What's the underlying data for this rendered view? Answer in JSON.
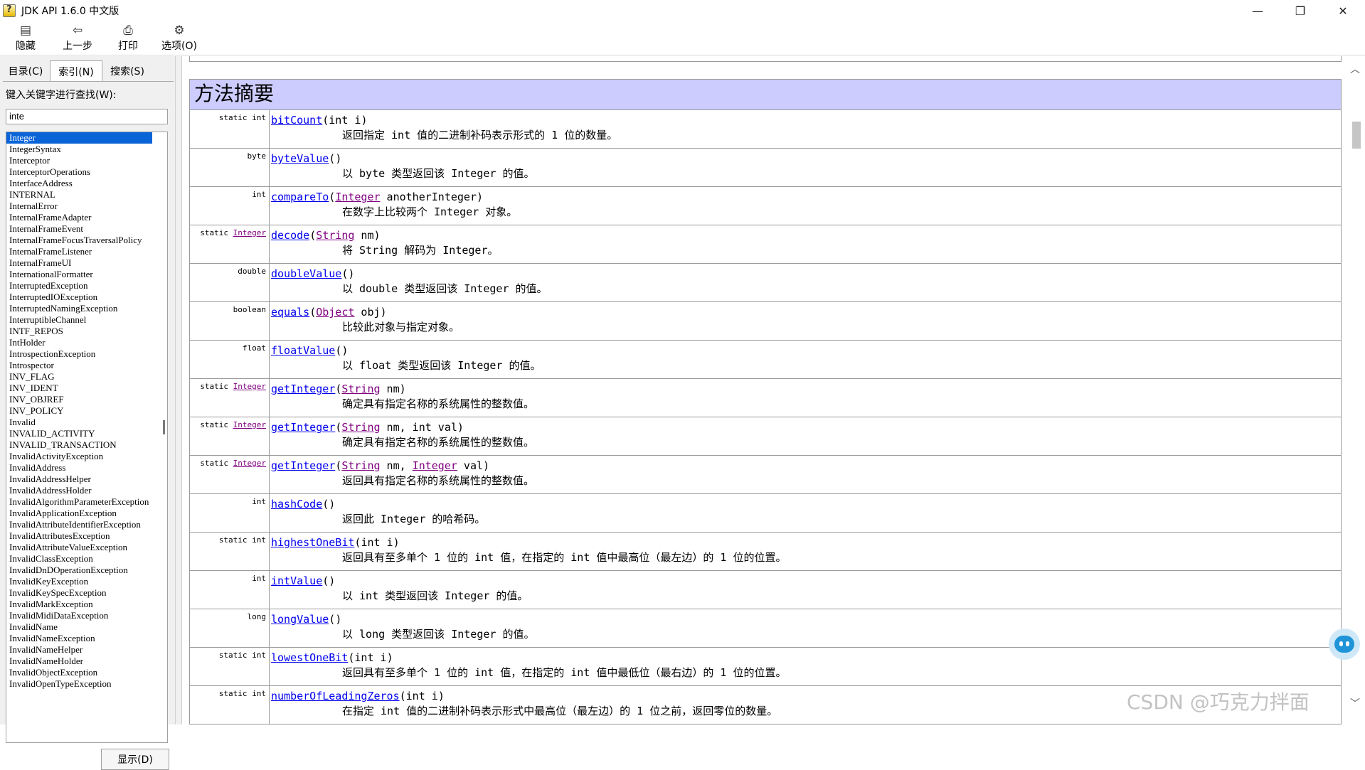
{
  "window": {
    "title": "JDK API 1.6.0 中文版",
    "minimize_glyph": "—",
    "restore_glyph": "❐",
    "close_glyph": "✕"
  },
  "toolbar": {
    "hide": {
      "label": "隐藏",
      "icon": "hide-icon",
      "glyph": "▤"
    },
    "back": {
      "label": "上一步",
      "icon": "back-arrow-icon",
      "glyph": "⇦"
    },
    "print": {
      "label": "打印",
      "icon": "printer-icon",
      "glyph": "⎙"
    },
    "options": {
      "label": "选项(O)",
      "icon": "options-icon",
      "glyph": "⚙"
    }
  },
  "left": {
    "tabs": [
      {
        "label": "目录(C)"
      },
      {
        "label": "索引(N)"
      },
      {
        "label": "搜索(S)"
      }
    ],
    "keyword_label": "键入关键字进行查找(W):",
    "keyword_value": "inte",
    "selected_item": "Integer",
    "items": [
      "Integer",
      "IntegerSyntax",
      "Interceptor",
      "InterceptorOperations",
      "InterfaceAddress",
      "INTERNAL",
      "InternalError",
      "InternalFrameAdapter",
      "InternalFrameEvent",
      "InternalFrameFocusTraversalPolicy",
      "InternalFrameListener",
      "InternalFrameUI",
      "InternationalFormatter",
      "InterruptedException",
      "InterruptedIOException",
      "InterruptedNamingException",
      "InterruptibleChannel",
      "INTF_REPOS",
      "IntHolder",
      "IntrospectionException",
      "Introspector",
      "INV_FLAG",
      "INV_IDENT",
      "INV_OBJREF",
      "INV_POLICY",
      "Invalid",
      "INVALID_ACTIVITY",
      "INVALID_TRANSACTION",
      "InvalidActivityException",
      "InvalidAddress",
      "InvalidAddressHelper",
      "InvalidAddressHolder",
      "InvalidAlgorithmParameterException",
      "InvalidApplicationException",
      "InvalidAttributeIdentifierException",
      "InvalidAttributesException",
      "InvalidAttributeValueException",
      "InvalidClassException",
      "InvalidDnDOperationException",
      "InvalidKeyException",
      "InvalidKeySpecException",
      "InvalidMarkException",
      "InvalidMidiDataException",
      "InvalidName",
      "InvalidNameException",
      "InvalidNameHelper",
      "InvalidNameHolder",
      "InvalidObjectException",
      "InvalidOpenTypeException"
    ],
    "show_button": "显示(D)"
  },
  "content": {
    "section_title": "方法摘要",
    "methods": [
      {
        "modifier": "static int",
        "modifier_link": "",
        "name": "bitCount",
        "params": [
          {
            "text": "int i",
            "link": false
          }
        ],
        "desc": "返回指定 int 值的二进制补码表示形式的 1 位的数量。"
      },
      {
        "modifier": "byte",
        "modifier_link": "",
        "name": "byteValue",
        "params": [],
        "desc": "以 byte 类型返回该 Integer 的值。"
      },
      {
        "modifier": "int",
        "modifier_link": "",
        "name": "compareTo",
        "params": [
          {
            "text": "Integer",
            "link": true
          },
          {
            "text": " anotherInteger",
            "link": false
          }
        ],
        "desc": "在数字上比较两个 Integer 对象。"
      },
      {
        "modifier": "static ",
        "modifier_link": "Integer",
        "name": "decode",
        "params": [
          {
            "text": "String",
            "link": true
          },
          {
            "text": " nm",
            "link": false
          }
        ],
        "desc": "将 String 解码为 Integer。"
      },
      {
        "modifier": "double",
        "modifier_link": "",
        "name": "doubleValue",
        "params": [],
        "desc": "以 double 类型返回该 Integer 的值。"
      },
      {
        "modifier": "boolean",
        "modifier_link": "",
        "name": "equals",
        "params": [
          {
            "text": "Object",
            "link": true
          },
          {
            "text": " obj",
            "link": false
          }
        ],
        "desc": "比较此对象与指定对象。"
      },
      {
        "modifier": "float",
        "modifier_link": "",
        "name": "floatValue",
        "params": [],
        "desc": "以 float 类型返回该 Integer 的值。"
      },
      {
        "modifier": "static ",
        "modifier_link": "Integer",
        "name": "getInteger",
        "params": [
          {
            "text": "String",
            "link": true
          },
          {
            "text": " nm",
            "link": false
          }
        ],
        "desc": "确定具有指定名称的系统属性的整数值。"
      },
      {
        "modifier": "static ",
        "modifier_link": "Integer",
        "name": "getInteger",
        "params": [
          {
            "text": "String",
            "link": true
          },
          {
            "text": " nm, int val",
            "link": false
          }
        ],
        "desc": "确定具有指定名称的系统属性的整数值。"
      },
      {
        "modifier": "static ",
        "modifier_link": "Integer",
        "name": "getInteger",
        "params": [
          {
            "text": "String",
            "link": true
          },
          {
            "text": " nm, ",
            "link": false
          },
          {
            "text": "Integer",
            "link": true
          },
          {
            "text": " val",
            "link": false
          }
        ],
        "desc": "返回具有指定名称的系统属性的整数值。"
      },
      {
        "modifier": "int",
        "modifier_link": "",
        "name": "hashCode",
        "params": [],
        "desc": "返回此 Integer 的哈希码。"
      },
      {
        "modifier": "static int",
        "modifier_link": "",
        "name": "highestOneBit",
        "params": [
          {
            "text": "int i",
            "link": false
          }
        ],
        "desc": "返回具有至多单个 1 位的 int 值，在指定的 int 值中最高位（最左边）的 1 位的位置。"
      },
      {
        "modifier": "int",
        "modifier_link": "",
        "name": "intValue",
        "params": [],
        "desc": "以 int 类型返回该 Integer 的值。"
      },
      {
        "modifier": "long",
        "modifier_link": "",
        "name": "longValue",
        "params": [],
        "desc": "以 long 类型返回该 Integer 的值。"
      },
      {
        "modifier": "static int",
        "modifier_link": "",
        "name": "lowestOneBit",
        "params": [
          {
            "text": "int i",
            "link": false
          }
        ],
        "desc": "返回具有至多单个 1 位的 int 值，在指定的 int 值中最低位（最右边）的 1 位的位置。"
      },
      {
        "modifier": "static int",
        "modifier_link": "",
        "name": "numberOfLeadingZeros",
        "params": [
          {
            "text": "int i",
            "link": false
          }
        ],
        "desc": "在指定 int 值的二进制补码表示形式中最高位（最左边）的 1 位之前，返回零位的数量。"
      }
    ]
  },
  "scrollbar": {
    "up_glyph": "︿",
    "down_glyph": "﹀"
  },
  "watermark": "CSDN @巧克力拌面",
  "colors": {
    "header_bg": "#ccccff",
    "link": "#0000ee",
    "visited_link": "#800080",
    "selection": "#0a64d8"
  }
}
